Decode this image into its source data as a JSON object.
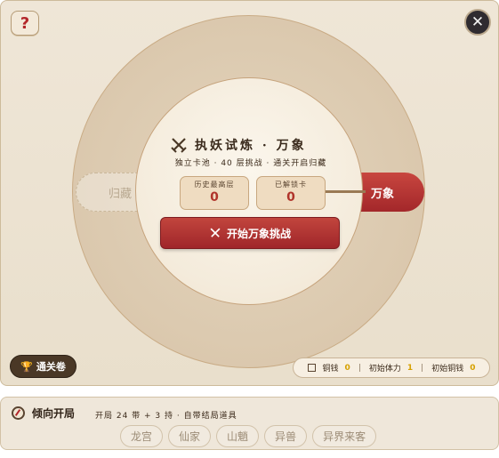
{
  "header": {
    "help_label": "?",
    "close_label": "✕"
  },
  "dial": {
    "left_option": "归藏",
    "right_option": "万象"
  },
  "challenge": {
    "title": "执妖试炼 · 万象",
    "subtitle": "独立卡池 · 40 层挑战 · 通关开启归藏",
    "stats": [
      {
        "label": "历史最高层",
        "value": "0"
      },
      {
        "label": "已解锁卡",
        "value": "0"
      }
    ],
    "start_button": "开始万象挑战"
  },
  "footer_left": {
    "pass_label": "通关卷"
  },
  "resources": [
    {
      "label": "铜钱",
      "value": "0"
    },
    {
      "label": "初始体力",
      "value": "1"
    },
    {
      "label": "初始铜钱",
      "value": "0"
    }
  ],
  "tendency": {
    "title": "倾向开局",
    "subtitle": "开局 24 带 + 3 持 · 自带结局道具",
    "options": [
      "龙宫",
      "仙家",
      "山魈",
      "异兽",
      "异界来客"
    ]
  },
  "colors": {
    "accent_red": "#b0342b",
    "gold": "#d6a100",
    "parchment": "#efe6d7"
  }
}
